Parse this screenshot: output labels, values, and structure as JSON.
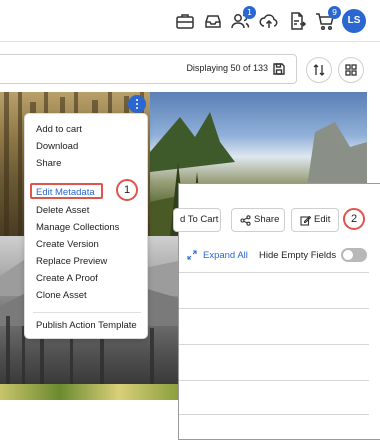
{
  "topbar": {
    "icons": [
      "briefcase-icon",
      "inbox-icon",
      "users-icon",
      "upload-icon",
      "document-export-icon",
      "cart-icon"
    ],
    "users_badge": "1",
    "cart_badge": "9",
    "avatar_initials": "LS",
    "accent_color": "#2b67d1"
  },
  "results": {
    "displaying_text": "Displaying 50 of 133"
  },
  "menu": {
    "items": [
      "Add to cart",
      "Download",
      "Share",
      "Edit Metadata",
      "Delete Asset",
      "Manage Collections",
      "Create Version",
      "Replace Preview",
      "Create A Proof",
      "Clone Asset",
      "Publish Action Template"
    ]
  },
  "steps": {
    "one": "1",
    "two": "2",
    "highlight_color": "#e0544a"
  },
  "panel": {
    "add_to_cart": "d To Cart",
    "share": "Share",
    "edit": "Edit",
    "expand_all": "Expand All",
    "hide_empty_fields": "Hide Empty Fields"
  }
}
